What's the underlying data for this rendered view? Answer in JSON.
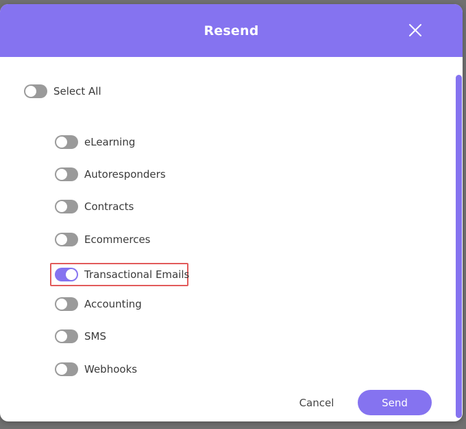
{
  "modal": {
    "title": "Resend",
    "close_icon": "close-icon"
  },
  "select_all": {
    "label": "Select All",
    "checked": false
  },
  "options": [
    {
      "label": "eLearning",
      "checked": false
    },
    {
      "label": "Autoresponders",
      "checked": false
    },
    {
      "label": "Contracts",
      "checked": false
    },
    {
      "label": "Ecommerces",
      "checked": false
    },
    {
      "label": "Transactional Emails",
      "checked": true
    },
    {
      "label": "Accounting",
      "checked": false
    },
    {
      "label": "SMS",
      "checked": false
    },
    {
      "label": "Webhooks",
      "checked": false
    }
  ],
  "footer": {
    "cancel_label": "Cancel",
    "send_label": "Send"
  },
  "colors": {
    "accent": "#8573f0",
    "toggle_off": "#9a9a9a",
    "highlight": "#e25a5a"
  }
}
